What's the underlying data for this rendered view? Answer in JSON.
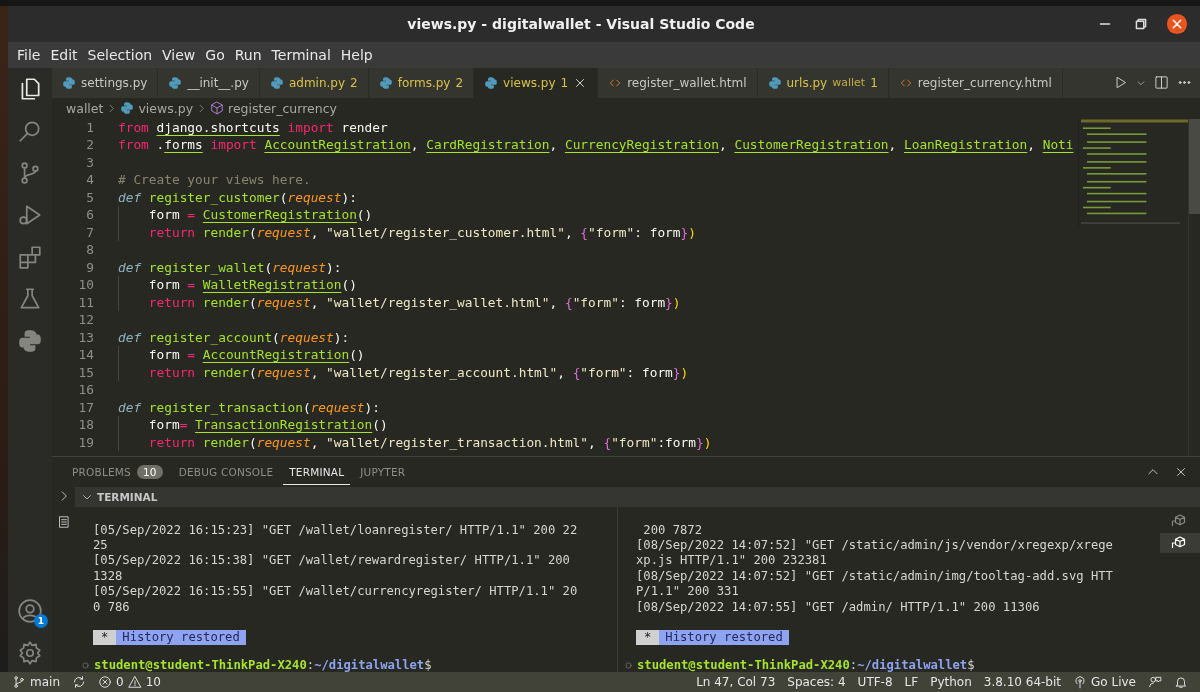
{
  "window": {
    "title": "views.py - digitalwallet - Visual Studio Code"
  },
  "menu": [
    "File",
    "Edit",
    "Selection",
    "View",
    "Go",
    "Run",
    "Terminal",
    "Help"
  ],
  "activity_bar": {
    "items": [
      {
        "kind": "files",
        "selected": true
      },
      {
        "kind": "search",
        "selected": false
      },
      {
        "kind": "scm",
        "selected": false
      },
      {
        "kind": "debug",
        "selected": false
      },
      {
        "kind": "extensions",
        "selected": false
      },
      {
        "kind": "testing",
        "selected": false
      },
      {
        "kind": "python",
        "selected": false
      },
      {
        "kind": "account",
        "selected": false,
        "badge": "1"
      },
      {
        "kind": "settings",
        "selected": false
      }
    ]
  },
  "tabs": [
    {
      "label": "settings.py",
      "kind": "python",
      "warning": false,
      "selected": false
    },
    {
      "label": "__init__.py",
      "kind": "python",
      "warning": false,
      "selected": false
    },
    {
      "label": "admin.py",
      "kind": "python",
      "badge": "2",
      "warning": true,
      "selected": false
    },
    {
      "label": "forms.py",
      "kind": "python",
      "badge": "2",
      "warning": true,
      "selected": false
    },
    {
      "label": "views.py",
      "kind": "python",
      "badge": "1",
      "warning": true,
      "selected": true
    },
    {
      "label": "register_wallet.html",
      "kind": "html",
      "warning": false,
      "selected": false
    },
    {
      "label": "urls.py",
      "kind": "python",
      "description": "wallet",
      "badge": "1",
      "warning": true,
      "selected": false
    },
    {
      "label": "register_currency.html",
      "kind": "html",
      "warning": false,
      "selected": false
    }
  ],
  "breadcrumb": [
    {
      "label": "wallet",
      "kind": "folder"
    },
    {
      "label": "views.py",
      "kind": "python"
    },
    {
      "label": "register_currency",
      "kind": "function"
    }
  ],
  "editor": {
    "lines": [
      {
        "number": "1",
        "indent": false,
        "tokens": [
          {
            "t": "from ",
            "kind": "keyword"
          },
          {
            "t": "django.shortcuts",
            "kind": "module"
          },
          {
            "t": " import",
            "kind": "keyword"
          },
          {
            "t": " render",
            "kind": "text"
          }
        ]
      },
      {
        "number": "2",
        "indent": false,
        "tokens": [
          {
            "t": "from",
            "kind": "keyword"
          },
          {
            "t": " .",
            "kind": "text"
          },
          {
            "t": "forms",
            "kind": "module"
          },
          {
            "t": " import ",
            "kind": "keyword"
          },
          {
            "t": "AccountRegistration",
            "kind": "class"
          },
          {
            "t": ", ",
            "kind": "text"
          },
          {
            "t": "CardRegistration",
            "kind": "class"
          },
          {
            "t": ", ",
            "kind": "text"
          },
          {
            "t": "CurrencyRegistration",
            "kind": "class"
          },
          {
            "t": ", ",
            "kind": "text"
          },
          {
            "t": "CustomerRegistration",
            "kind": "class"
          },
          {
            "t": ", ",
            "kind": "text"
          },
          {
            "t": "LoanRegistration",
            "kind": "class"
          },
          {
            "t": ", ",
            "kind": "text"
          },
          {
            "t": "Noti",
            "kind": "class"
          }
        ]
      },
      {
        "number": "3",
        "indent": false
      },
      {
        "number": "4",
        "indent": false,
        "tokens": [
          {
            "t": "# Create your views here.",
            "kind": "comment"
          }
        ]
      },
      {
        "number": "5",
        "indent": false,
        "tokens": [
          {
            "t": "def ",
            "kind": "definition"
          },
          {
            "t": "register_customer",
            "kind": "function"
          },
          {
            "t": "(",
            "kind": "text"
          },
          {
            "t": "request",
            "kind": "parameter"
          },
          {
            "t": "):",
            "kind": "text"
          }
        ]
      },
      {
        "number": "6",
        "indent": true,
        "tokens": [
          {
            "t": "form ",
            "kind": "text"
          },
          {
            "t": "= ",
            "kind": "keyword"
          },
          {
            "t": "CustomerRegistration",
            "kind": "class"
          },
          {
            "t": "()",
            "kind": "text"
          }
        ]
      },
      {
        "number": "7",
        "indent": true,
        "tokens": [
          {
            "t": "return ",
            "kind": "keyword"
          },
          {
            "t": "render",
            "kind": "function"
          },
          {
            "t": "(",
            "kind": "text"
          },
          {
            "t": "request",
            "kind": "parameter"
          },
          {
            "t": ", ",
            "kind": "text"
          },
          {
            "t": "\"wallet/register_customer.html\"",
            "kind": "string"
          },
          {
            "t": ", ",
            "kind": "text"
          },
          {
            "t": "{",
            "kind": "brace"
          },
          {
            "t": "\"form\"",
            "kind": "string"
          },
          {
            "t": ": form",
            "kind": "text"
          },
          {
            "t": "}",
            "kind": "brace"
          },
          {
            "t": ")",
            "kind": "paren"
          }
        ]
      },
      {
        "number": "8",
        "indent": false
      },
      {
        "number": "9",
        "indent": false,
        "tokens": [
          {
            "t": "def ",
            "kind": "definition"
          },
          {
            "t": "register_wallet",
            "kind": "function"
          },
          {
            "t": "(",
            "kind": "text"
          },
          {
            "t": "request",
            "kind": "parameter"
          },
          {
            "t": "):",
            "kind": "text"
          }
        ]
      },
      {
        "number": "10",
        "indent": true,
        "tokens": [
          {
            "t": "form ",
            "kind": "text"
          },
          {
            "t": "= ",
            "kind": "keyword"
          },
          {
            "t": "WalletRegistration",
            "kind": "class"
          },
          {
            "t": "()",
            "kind": "text"
          }
        ]
      },
      {
        "number": "11",
        "indent": true,
        "tokens": [
          {
            "t": "return ",
            "kind": "keyword"
          },
          {
            "t": "render",
            "kind": "function"
          },
          {
            "t": "(",
            "kind": "text"
          },
          {
            "t": "request",
            "kind": "parameter"
          },
          {
            "t": ", ",
            "kind": "text"
          },
          {
            "t": "\"wallet/register_wallet.html\"",
            "kind": "string"
          },
          {
            "t": ", ",
            "kind": "text"
          },
          {
            "t": "{",
            "kind": "brace"
          },
          {
            "t": "\"form\"",
            "kind": "string"
          },
          {
            "t": ": form",
            "kind": "text"
          },
          {
            "t": "}",
            "kind": "brace"
          },
          {
            "t": ")",
            "kind": "paren"
          }
        ]
      },
      {
        "number": "12",
        "indent": false
      },
      {
        "number": "13",
        "indent": false,
        "tokens": [
          {
            "t": "def ",
            "kind": "definition"
          },
          {
            "t": "register_account",
            "kind": "function"
          },
          {
            "t": "(",
            "kind": "text"
          },
          {
            "t": "request",
            "kind": "parameter"
          },
          {
            "t": "):",
            "kind": "text"
          }
        ]
      },
      {
        "number": "14",
        "indent": true,
        "tokens": [
          {
            "t": "form ",
            "kind": "text"
          },
          {
            "t": "= ",
            "kind": "keyword"
          },
          {
            "t": "AccountRegistration",
            "kind": "class"
          },
          {
            "t": "()",
            "kind": "text"
          }
        ]
      },
      {
        "number": "15",
        "indent": true,
        "tokens": [
          {
            "t": "return ",
            "kind": "keyword"
          },
          {
            "t": "render",
            "kind": "function"
          },
          {
            "t": "(",
            "kind": "text"
          },
          {
            "t": "request",
            "kind": "parameter"
          },
          {
            "t": ", ",
            "kind": "text"
          },
          {
            "t": "\"wallet/register_account.html\"",
            "kind": "string"
          },
          {
            "t": ", ",
            "kind": "text"
          },
          {
            "t": "{",
            "kind": "brace"
          },
          {
            "t": "\"form\"",
            "kind": "string"
          },
          {
            "t": ": form",
            "kind": "text"
          },
          {
            "t": "}",
            "kind": "brace"
          },
          {
            "t": ")",
            "kind": "paren"
          }
        ]
      },
      {
        "number": "16",
        "indent": false
      },
      {
        "number": "17",
        "indent": false,
        "tokens": [
          {
            "t": "def ",
            "kind": "definition"
          },
          {
            "t": "register_transaction",
            "kind": "function"
          },
          {
            "t": "(",
            "kind": "text"
          },
          {
            "t": "request",
            "kind": "parameter"
          },
          {
            "t": "):",
            "kind": "text"
          }
        ]
      },
      {
        "number": "18",
        "indent": true,
        "tokens": [
          {
            "t": "form",
            "kind": "text"
          },
          {
            "t": "= ",
            "kind": "keyword"
          },
          {
            "t": "TransactionRegistration",
            "kind": "class"
          },
          {
            "t": "()",
            "kind": "text"
          }
        ]
      },
      {
        "number": "19",
        "indent": true,
        "tokens": [
          {
            "t": "return ",
            "kind": "keyword"
          },
          {
            "t": "render",
            "kind": "function"
          },
          {
            "t": "(",
            "kind": "text"
          },
          {
            "t": "request",
            "kind": "parameter"
          },
          {
            "t": ", ",
            "kind": "text"
          },
          {
            "t": "\"wallet/register_transaction.html\"",
            "kind": "string"
          },
          {
            "t": ", ",
            "kind": "text"
          },
          {
            "t": "{",
            "kind": "brace"
          },
          {
            "t": "\"form\"",
            "kind": "string"
          },
          {
            "t": ":form",
            "kind": "text"
          },
          {
            "t": "}",
            "kind": "brace"
          },
          {
            "t": ")",
            "kind": "paren"
          }
        ]
      }
    ]
  },
  "panel": {
    "tabs": [
      {
        "label": "PROBLEMS",
        "badge": "10",
        "selected": false
      },
      {
        "label": "DEBUG CONSOLE",
        "selected": false
      },
      {
        "label": "TERMINAL",
        "selected": true
      },
      {
        "label": "JUPYTER",
        "selected": false
      }
    ],
    "section": "TERMINAL",
    "terminals": [
      {
        "lines": [
          "[05/Sep/2022 16:15:23] \"GET /wallet/loanregister/ HTTP/1.1\" 200 22",
          "25",
          "[05/Sep/2022 16:15:38] \"GET /wallet/rewardregister/ HTTP/1.1\" 200",
          "1328",
          "[05/Sep/2022 16:15:55] \"GET /wallet/currencyregister/ HTTP/1.1\" 20",
          "0 786"
        ],
        "history": {
          "mark": "*",
          "label": "History restored"
        },
        "prompt": {
          "user": "student@student-ThinkPad-X240",
          "sep": ":",
          "path": "~/digitalwallet",
          "symbol": "$"
        }
      },
      {
        "lines": [
          " 200 7872",
          "[08/Sep/2022 14:07:52] \"GET /static/admin/js/vendor/xregexp/xrege",
          "xp.js HTTP/1.1\" 200 232381",
          "[08/Sep/2022 14:07:52] \"GET /static/admin/img/tooltag-add.svg HTT",
          "P/1.1\" 200 331",
          "[08/Sep/2022 14:07:55] \"GET /admin/ HTTP/1.1\" 200 11306"
        ],
        "history": {
          "mark": "*",
          "label": "History restored"
        },
        "prompt": {
          "user": "student@student-ThinkPad-X240",
          "sep": ":",
          "path": "~/digitalwallet",
          "symbol": "$"
        }
      }
    ],
    "terminal_list": [
      {
        "selected": false
      },
      {
        "selected": true
      }
    ]
  },
  "status_bar": {
    "branch": "main",
    "errors": "0",
    "warnings": "10",
    "items": [
      {
        "label": "Ln 47, Col 73",
        "kind": "plain"
      },
      {
        "label": "Spaces: 4",
        "kind": "plain"
      },
      {
        "label": "UTF-8",
        "kind": "plain"
      },
      {
        "label": "LF",
        "kind": "plain"
      },
      {
        "label": "Python",
        "kind": "plain"
      },
      {
        "label": "3.8.10 64-bit",
        "kind": "plain"
      },
      {
        "label": "Go Live",
        "kind": "live"
      }
    ]
  }
}
